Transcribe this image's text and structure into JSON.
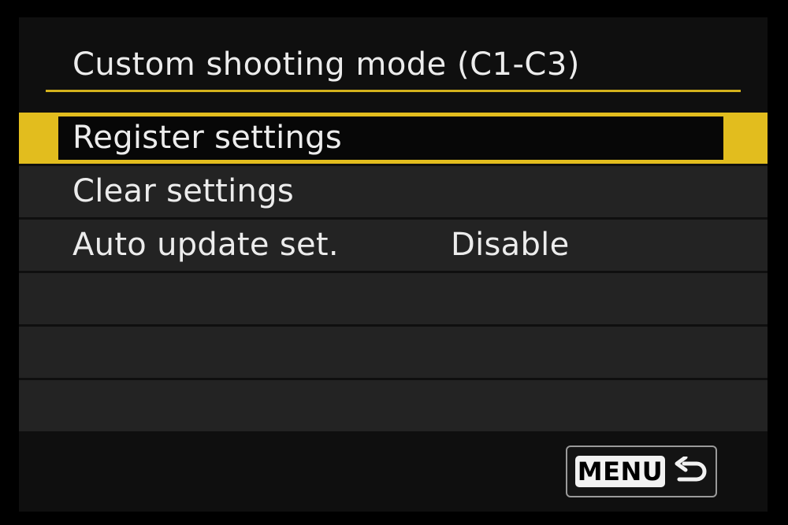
{
  "screen": {
    "title": "Custom shooting mode (C1-C3)"
  },
  "menu": {
    "items": [
      {
        "label": "Register settings",
        "value": "",
        "selected": true
      },
      {
        "label": "Clear settings",
        "value": "",
        "selected": false
      },
      {
        "label": "Auto update set.",
        "value": "Disable",
        "selected": false
      },
      {
        "label": "",
        "value": "",
        "selected": false
      },
      {
        "label": "",
        "value": "",
        "selected": false
      },
      {
        "label": "",
        "value": "",
        "selected": false
      }
    ]
  },
  "footer": {
    "menu_button_label": "MENU",
    "return_icon": "return-arrow-icon"
  },
  "colors": {
    "accent": "#e2bd1e",
    "background": "#0f0f0f",
    "row": "#232323",
    "text": "#ececec"
  }
}
